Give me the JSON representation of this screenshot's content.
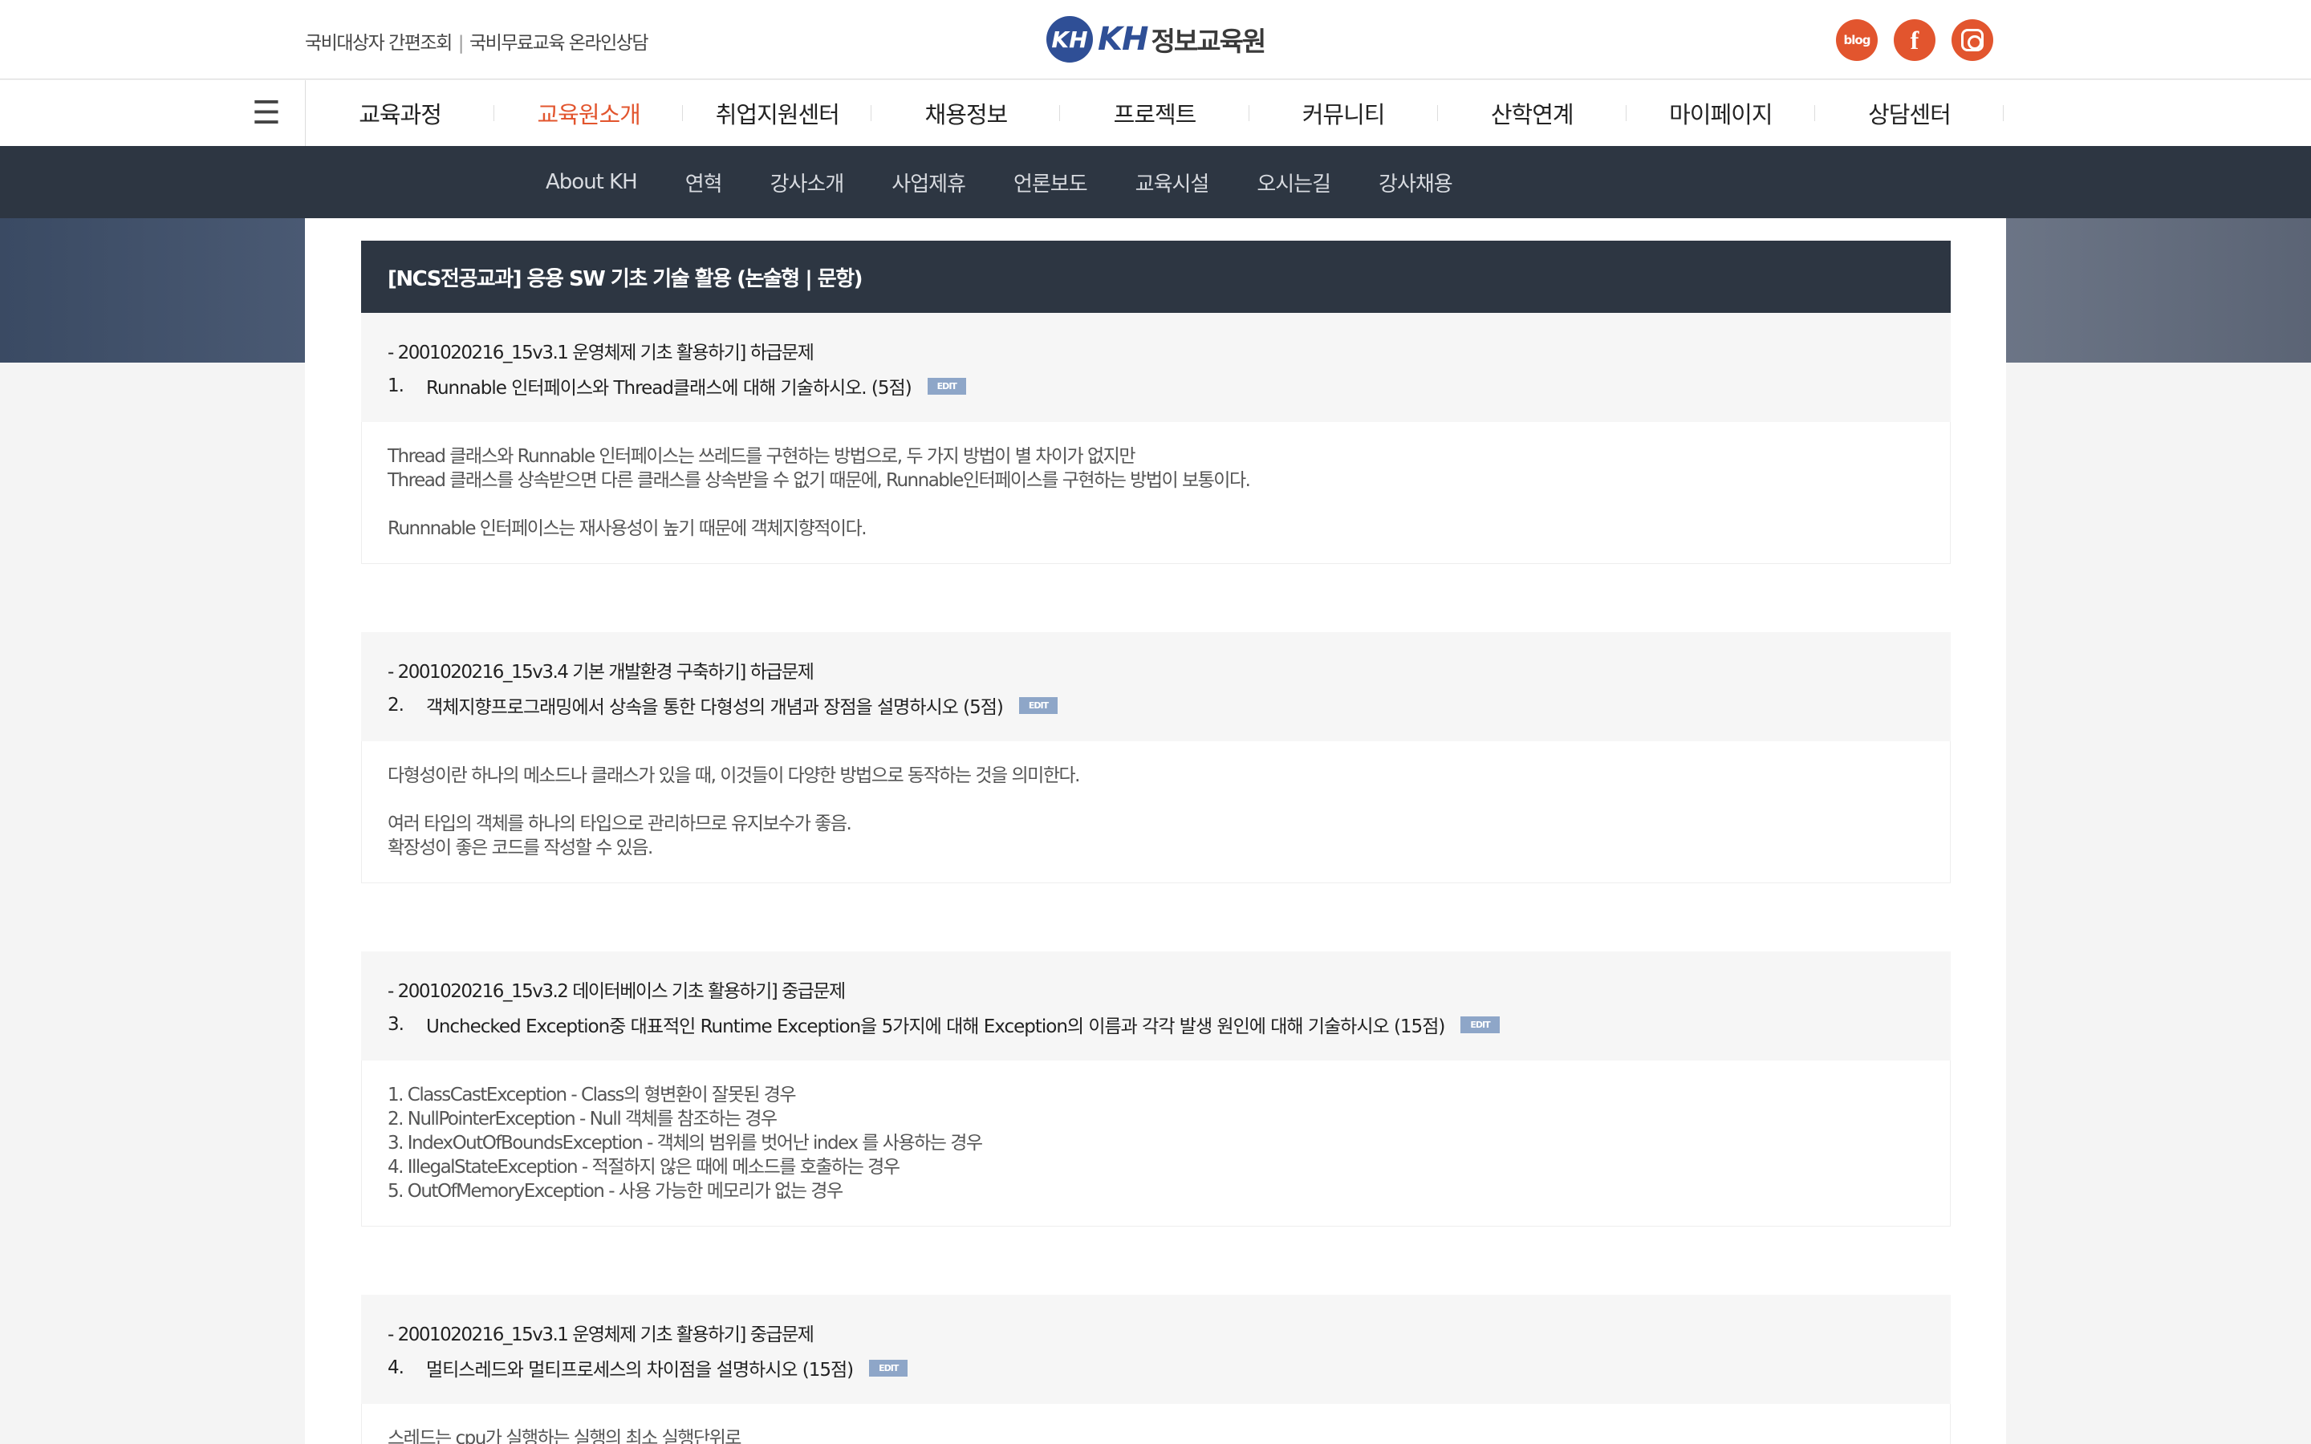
{
  "header": {
    "top_links": [
      "국비대상자 간편조회",
      "국비무료교육 온라인상담"
    ],
    "logo": {
      "mark": "KH",
      "kh": "KH",
      "name": "정보교육원"
    },
    "social": [
      {
        "icon": "blog-icon",
        "label": "blog"
      },
      {
        "icon": "facebook-icon",
        "label": "f"
      },
      {
        "icon": "instagram-icon",
        "label": ""
      }
    ],
    "accent_color": "#e2552e"
  },
  "main_nav": {
    "menu_icon": "hamburger-menu-icon",
    "items": [
      "교육과정",
      "교육원소개",
      "취업지원센터",
      "채용정보",
      "프로젝트",
      "커뮤니티",
      "산학연계",
      "마이페이지",
      "상담센터"
    ],
    "active_index": 1
  },
  "sub_nav": {
    "items": [
      "About KH",
      "연혁",
      "강사소개",
      "사업제휴",
      "언론보도",
      "교육시설",
      "오시는길",
      "강사채용"
    ]
  },
  "exam": {
    "title": "[NCS전공교과] 응용 SW 기초 기술 활용 (논술형 | 문항)",
    "edit_label": "EDIT",
    "questions": [
      {
        "category": "- 2001020216_15v3.1 운영체제 기초 활용하기]   하급문제",
        "number": "1.",
        "text": "Runnable 인터페이스와 Thread클래스에 대해 기술하시오.  (5점)",
        "answer": [
          "Thread 클래스와 Runnable 인터페이스는 쓰레드를 구현하는 방법으로, 두 가지 방법이 별 차이가 없지만",
          "Thread 클래스를 상속받으면 다른 클래스를 상속받을 수 없기 때문에, Runnable인터페이스를 구현하는 방법이 보통이다.",
          "",
          "Runnnable 인터페이스는 재사용성이 높기 때문에 객체지향적이다."
        ]
      },
      {
        "category": "- 2001020216_15v3.4 기본 개발환경 구축하기]   하급문제",
        "number": "2.",
        "text": "객체지향프로그래밍에서 상속을 통한 다형성의 개념과 장점을 설명하시오 (5점)",
        "answer": [
          "다형성이란 하나의 메소드나 클래스가 있을 때, 이것들이 다양한 방법으로 동작하는 것을 의미한다.",
          "",
          "여러 타입의 객체를 하나의 타입으로 관리하므로 유지보수가 좋음.",
          "확장성이 좋은 코드를 작성할 수 있음."
        ]
      },
      {
        "category": "- 2001020216_15v3.2 데이터베이스 기초 활용하기]   중급문제",
        "number": "3.",
        "text": "Unchecked Exception중 대표적인 Runtime Exception을 5가지에 대해 Exception의 이름과 각각 발생 원인에 대해 기술하시오 (15점)",
        "answer": [
          "1. ClassCastException  - Class의 형변환이 잘못된 경우",
          "2. NullPointerException -  Null 객체를 참조하는 경우",
          "3. IndexOutOfBoundsException - 객체의 범위를 벗어난 index 를 사용하는 경우",
          "4. IllegalStateException - 적절하지 않은 때에 메소드를 호출하는 경우",
          "5. OutOfMemoryException - 사용 가능한 메모리가 없는 경우"
        ]
      },
      {
        "category": "- 2001020216_15v3.1 운영체제 기초 활용하기]   중급문제",
        "number": "4.",
        "text": "멀티스레드와 멀티프로세스의 차이점을 설명하시오 (15점)",
        "answer": [
          "스레드는 cpu가 실행하는 실행의 최소 실행단위로"
        ]
      }
    ]
  }
}
